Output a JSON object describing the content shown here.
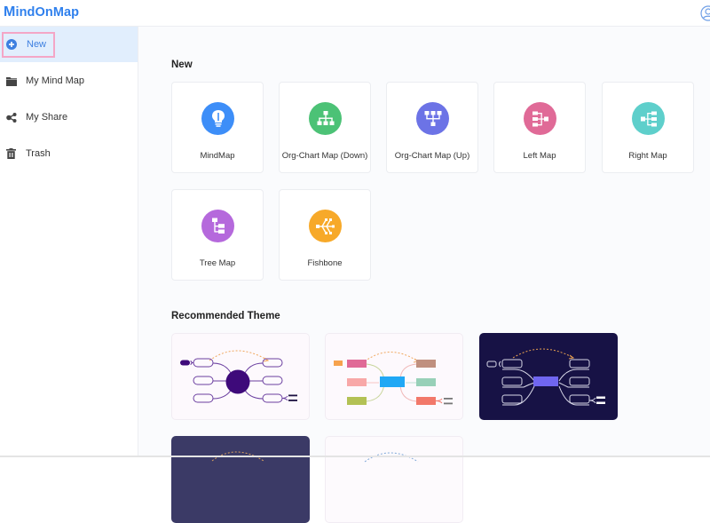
{
  "app": {
    "logo_first": "M",
    "logo_rest": "indOnMap",
    "brand_color": "#2f80ed"
  },
  "sidebar": {
    "items": [
      {
        "label": "New",
        "icon": "plus-circle-icon",
        "active": true
      },
      {
        "label": "My Mind Map",
        "icon": "folder-icon",
        "active": false
      },
      {
        "label": "My Share",
        "icon": "share-icon",
        "active": false
      },
      {
        "label": "Trash",
        "icon": "trash-icon",
        "active": false
      }
    ]
  },
  "main": {
    "new_title": "New",
    "templates": [
      {
        "label": "MindMap",
        "icon": "lightbulb-icon",
        "color": "#3d8ef8"
      },
      {
        "label": "Org-Chart Map (Down)",
        "icon": "org-chart-down-icon",
        "color": "#4cc276"
      },
      {
        "label": "Org-Chart Map (Up)",
        "icon": "org-chart-up-icon",
        "color": "#6c73e6"
      },
      {
        "label": "Left Map",
        "icon": "left-map-icon",
        "color": "#e06a97"
      },
      {
        "label": "Right Map",
        "icon": "right-map-icon",
        "color": "#5ecfcb"
      },
      {
        "label": "Tree Map",
        "icon": "tree-map-icon",
        "color": "#b569dc"
      },
      {
        "label": "Fishbone",
        "icon": "fishbone-icon",
        "color": "#f7a929"
      }
    ],
    "recommended_title": "Recommended Theme",
    "themes": [
      {
        "name": "theme-purple-classic",
        "bg": "#fdf9fd",
        "center": "#3e0a7a"
      },
      {
        "name": "theme-colorful",
        "bg": "#fdf9fd",
        "center": "#20a8f5"
      },
      {
        "name": "theme-dark-navy",
        "bg": "#171245",
        "center": "#7066f0"
      },
      {
        "name": "theme-slate",
        "bg": "#3b3a66",
        "center": ""
      },
      {
        "name": "theme-light",
        "bg": "#fdfafd",
        "center": ""
      }
    ]
  }
}
